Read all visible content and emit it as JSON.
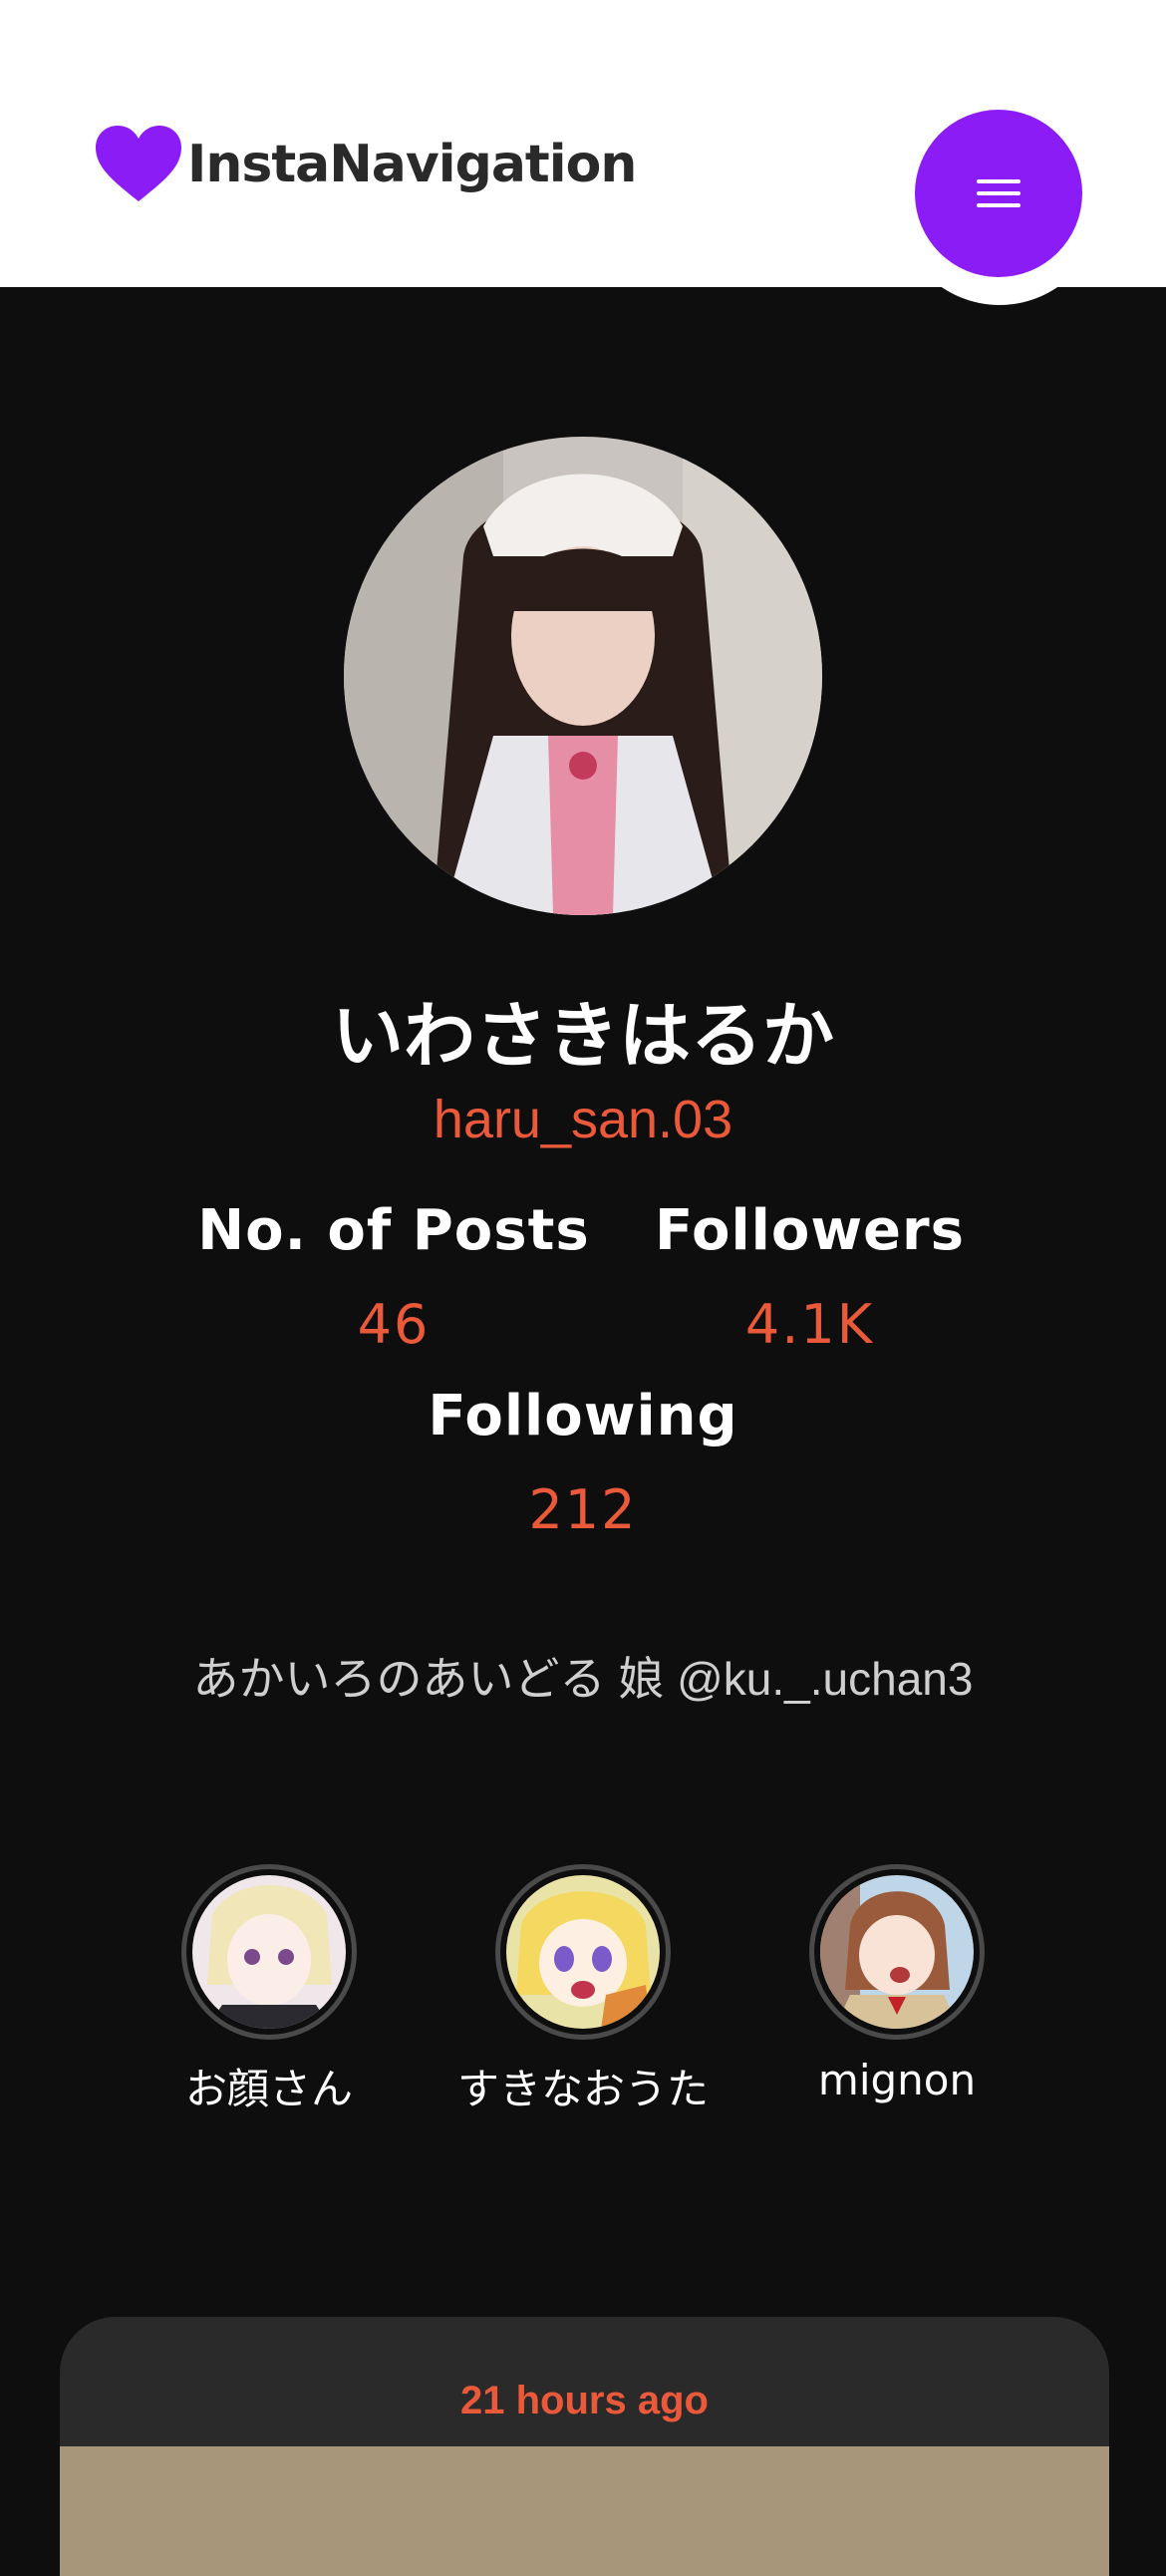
{
  "header": {
    "brand": "InstaNavigation",
    "brand_icon": "heart-icon",
    "menu_icon": "hamburger-menu-icon",
    "accent_color": "#8b1cf6"
  },
  "profile": {
    "display_name": "いわさきはるか",
    "username": "haru_san.03",
    "bio": "あかいろのあいどる 娘 @ku._.uchan3"
  },
  "stats": {
    "posts_label": "No. of Posts",
    "posts_value": "46",
    "followers_label": "Followers",
    "followers_value": "4.1K",
    "following_label": "Following",
    "following_value": "212",
    "value_color": "#ea5a3a"
  },
  "highlights": [
    {
      "label": "お顔さん"
    },
    {
      "label": "すきなおうた"
    },
    {
      "label": "mignon"
    }
  ],
  "post": {
    "timestamp": "21 hours ago"
  }
}
